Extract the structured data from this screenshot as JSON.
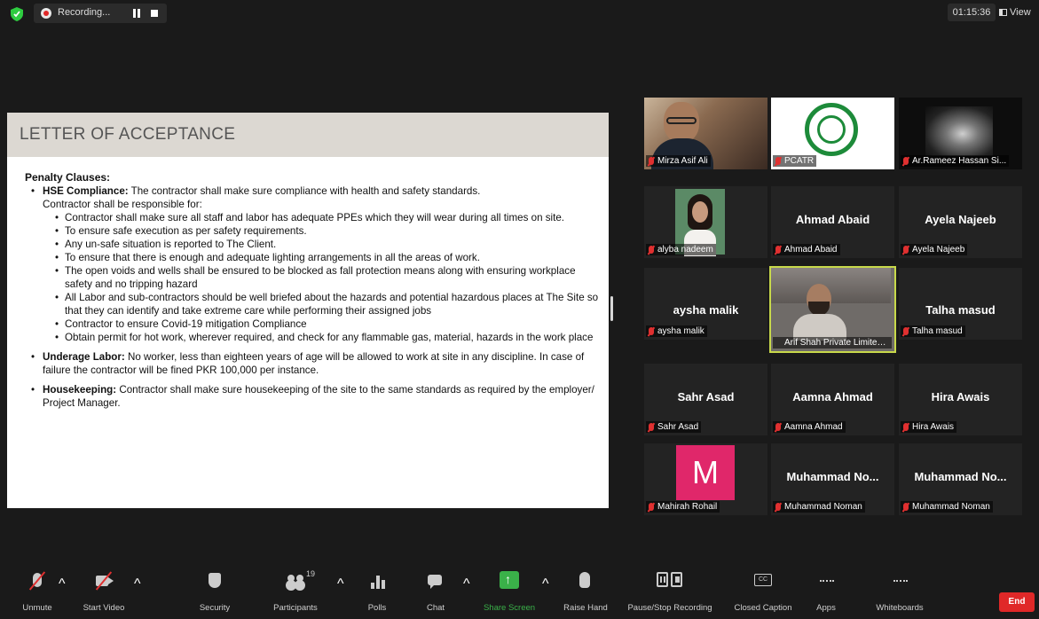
{
  "topbar": {
    "recording_label": "Recording...",
    "timer": "01:15:36",
    "view_label": "View"
  },
  "slide": {
    "title": "LETTER OF ACCEPTANCE",
    "penalty_heading": "Penalty Clauses:",
    "hse": {
      "title": "HSE Compliance:",
      "text": " The contractor shall make sure compliance with health and safety standards.",
      "text2": "Contractor shall be responsible for:",
      "items": [
        "Contractor shall make sure all staff and labor has adequate PPEs which they will wear during all times on site.",
        "To ensure safe execution as per safety requirements.",
        "Any un-safe situation is reported to The Client.",
        "To ensure that there is enough and adequate lighting arrangements in all the areas of work.",
        "The open voids and wells shall be ensured to be blocked as fall protection means along with ensuring workplace safety and no tripping hazard",
        "All Labor and sub-contractors should be well briefed about the hazards and potential hazardous places at The Site so that they can identify and take extreme care while performing their assigned jobs",
        "Contractor to ensure Covid-19 mitigation Compliance",
        "Obtain permit for hot work, wherever required, and check for any flammable gas, material, hazards in the work place"
      ]
    },
    "underage": {
      "title": "Underage Labor:",
      "text": " No worker, less than eighteen years of age will be allowed to work at site in any discipline. In case of failure the contractor will be fined PKR 100,000 per instance."
    },
    "housekeeping": {
      "title": "Housekeeping:",
      "text": " Contractor shall make sure housekeeping of the site to the same standards as required by the employer/ Project Manager."
    }
  },
  "participants": [
    {
      "label": "Mirza Asif Ali",
      "display": ""
    },
    {
      "label": "PCATR",
      "display": ""
    },
    {
      "label": "Ar.Rameez Hassan Si...",
      "display": ""
    },
    {
      "label": "alyba nadeem",
      "display": ""
    },
    {
      "label": "Ahmad Abaid",
      "display": "Ahmad Abaid"
    },
    {
      "label": "Ayela Najeeb",
      "display": "Ayela Najeeb"
    },
    {
      "label": "aysha malik",
      "display": "aysha malik"
    },
    {
      "label": "Arif Shah Private Limited...",
      "display": ""
    },
    {
      "label": "Talha masud",
      "display": "Talha masud"
    },
    {
      "label": "Sahr Asad",
      "display": "Sahr Asad"
    },
    {
      "label": "Aamna Ahmad",
      "display": "Aamna Ahmad"
    },
    {
      "label": "Hira Awais",
      "display": "Hira Awais"
    },
    {
      "label": "Mahirah Rohail",
      "display": "",
      "avatar_letter": "M",
      "avatar_color": "#e0276a"
    },
    {
      "label": "Muhammad Noman",
      "display": "Muhammad  No..."
    },
    {
      "label": "Muhammad Noman",
      "display": "Muhammad  No..."
    }
  ],
  "toolbar": {
    "unmute": "Unmute",
    "start_video": "Start Video",
    "security": "Security",
    "participants": "Participants",
    "participants_count": "19",
    "polls": "Polls",
    "chat": "Chat",
    "share_screen": "Share Screen",
    "raise_hand": "Raise Hand",
    "pause_recording": "Pause/Stop Recording",
    "closed_caption": "Closed Caption",
    "closed_caption_icon": "CC",
    "apps": "Apps",
    "whiteboards": "Whiteboards",
    "end": "End",
    "share_color": "#3ab149",
    "end_color": "#e02828"
  }
}
